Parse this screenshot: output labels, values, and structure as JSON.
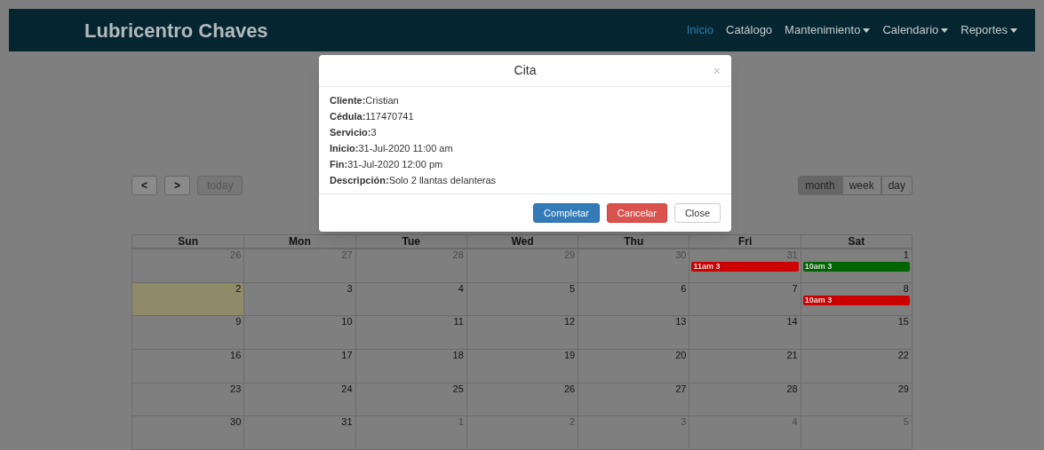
{
  "navbar": {
    "brand": "Lubricentro Chaves",
    "items": [
      {
        "label": "Inicio",
        "selected": true,
        "dropdown": false
      },
      {
        "label": "Catálogo",
        "selected": false,
        "dropdown": false
      },
      {
        "label": "Mantenimiento",
        "selected": false,
        "dropdown": true
      },
      {
        "label": "Calendario",
        "selected": false,
        "dropdown": true
      },
      {
        "label": "Reportes",
        "selected": false,
        "dropdown": true
      }
    ]
  },
  "calendar": {
    "nav_buttons": [
      {
        "label": "<",
        "disabled": false
      },
      {
        "label": ">",
        "disabled": false
      },
      {
        "label": "today",
        "disabled": true
      }
    ],
    "views": [
      {
        "label": "month",
        "selected": true
      },
      {
        "label": "week",
        "selected": false
      },
      {
        "label": "day",
        "selected": false
      }
    ],
    "weekdays": [
      "Sun",
      "Mon",
      "Tue",
      "Wed",
      "Thu",
      "Fri",
      "Sat"
    ],
    "weeks": [
      [
        {
          "day": "26",
          "other_month": true,
          "today": false
        },
        {
          "day": "27",
          "other_month": true,
          "today": false
        },
        {
          "day": "28",
          "other_month": true,
          "today": false
        },
        {
          "day": "29",
          "other_month": true,
          "today": false
        },
        {
          "day": "30",
          "other_month": true,
          "today": false
        },
        {
          "day": "31",
          "other_month": true,
          "today": false,
          "events": [
            {
              "label": "11am 3",
              "color": "#cc0000"
            }
          ]
        },
        {
          "day": "1",
          "other_month": false,
          "today": false,
          "events": [
            {
              "label": "10am 3",
              "color": "#006400"
            }
          ]
        }
      ],
      [
        {
          "day": "2",
          "other_month": false,
          "today": true
        },
        {
          "day": "3",
          "other_month": false,
          "today": false
        },
        {
          "day": "4",
          "other_month": false,
          "today": false
        },
        {
          "day": "5",
          "other_month": false,
          "today": false
        },
        {
          "day": "6",
          "other_month": false,
          "today": false
        },
        {
          "day": "7",
          "other_month": false,
          "today": false
        },
        {
          "day": "8",
          "other_month": false,
          "today": false,
          "events": [
            {
              "label": "10am 3",
              "color": "#cc0000"
            }
          ]
        }
      ],
      [
        {
          "day": "9",
          "other_month": false,
          "today": false
        },
        {
          "day": "10",
          "other_month": false,
          "today": false
        },
        {
          "day": "11",
          "other_month": false,
          "today": false
        },
        {
          "day": "12",
          "other_month": false,
          "today": false
        },
        {
          "day": "13",
          "other_month": false,
          "today": false
        },
        {
          "day": "14",
          "other_month": false,
          "today": false
        },
        {
          "day": "15",
          "other_month": false,
          "today": false
        }
      ],
      [
        {
          "day": "16",
          "other_month": false,
          "today": false
        },
        {
          "day": "17",
          "other_month": false,
          "today": false
        },
        {
          "day": "18",
          "other_month": false,
          "today": false
        },
        {
          "day": "19",
          "other_month": false,
          "today": false
        },
        {
          "day": "20",
          "other_month": false,
          "today": false
        },
        {
          "day": "21",
          "other_month": false,
          "today": false
        },
        {
          "day": "22",
          "other_month": false,
          "today": false
        }
      ],
      [
        {
          "day": "23",
          "other_month": false,
          "today": false
        },
        {
          "day": "24",
          "other_month": false,
          "today": false
        },
        {
          "day": "25",
          "other_month": false,
          "today": false
        },
        {
          "day": "26",
          "other_month": false,
          "today": false
        },
        {
          "day": "27",
          "other_month": false,
          "today": false
        },
        {
          "day": "28",
          "other_month": false,
          "today": false
        },
        {
          "day": "29",
          "other_month": false,
          "today": false
        }
      ],
      [
        {
          "day": "30",
          "other_month": false,
          "today": false
        },
        {
          "day": "31",
          "other_month": false,
          "today": false
        },
        {
          "day": "1",
          "other_month": true,
          "today": false
        },
        {
          "day": "2",
          "other_month": true,
          "today": false
        },
        {
          "day": "3",
          "other_month": true,
          "today": false
        },
        {
          "day": "4",
          "other_month": true,
          "today": false
        },
        {
          "day": "5",
          "other_month": true,
          "today": false
        }
      ]
    ]
  },
  "modal": {
    "title": "Cita",
    "close_glyph": "×",
    "fields": [
      {
        "label": "Cliente:",
        "value": "Cristian"
      },
      {
        "label": "Cédula:",
        "value": "117470741"
      },
      {
        "label": "Servicio:",
        "value": "3"
      },
      {
        "label": "Inicio:",
        "value": "31-Jul-2020 11:00 am"
      },
      {
        "label": "Fin:",
        "value": "31-Jul-2020 12:00 pm"
      },
      {
        "label": "Descripción:",
        "value": "Solo 2 llantas delanteras"
      }
    ],
    "buttons": [
      {
        "label": "Completar",
        "kind": "primary"
      },
      {
        "label": "Cancelar",
        "kind": "danger"
      },
      {
        "label": "Close",
        "kind": "default"
      }
    ]
  }
}
